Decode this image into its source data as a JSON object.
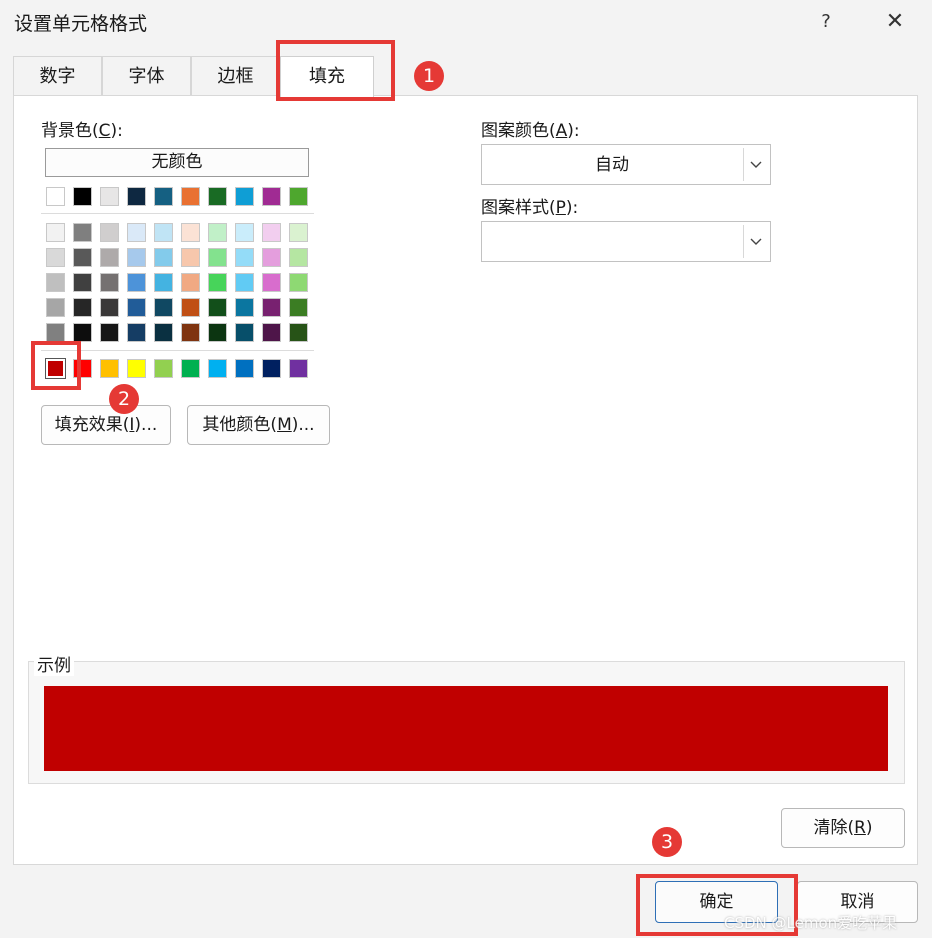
{
  "dialog": {
    "title": "设置单元格格式",
    "help_glyph": "?",
    "close_glyph": "✕"
  },
  "tabs": [
    {
      "label": "数字",
      "active": false
    },
    {
      "label": "字体",
      "active": false
    },
    {
      "label": "边框",
      "active": false
    },
    {
      "label": "填充",
      "active": true
    }
  ],
  "background_color": {
    "label_prefix": "背景色(",
    "accelerator": "C",
    "label_suffix": "):",
    "no_color_label": "无颜色",
    "theme_row": [
      "#ffffff",
      "#000000",
      "#e7e6e6",
      "#0e2841",
      "#156082",
      "#e97132",
      "#196b24",
      "#0f9ed5",
      "#a02b93",
      "#4ea72e"
    ],
    "tint_rows": [
      [
        "#f2f2f2",
        "#7f7f7f",
        "#d0cece",
        "#dae9f8",
        "#c0e4f5",
        "#fbe2d5",
        "#c1f0c8",
        "#caedfb",
        "#f2ceef",
        "#daf2d0"
      ],
      [
        "#d9d9d9",
        "#595959",
        "#aeaaaa",
        "#a6c9ec",
        "#83cbeb",
        "#f7c7ac",
        "#83e28e",
        "#94dcf8",
        "#e49edd",
        "#b5e6a2"
      ],
      [
        "#bfbfbf",
        "#404040",
        "#757171",
        "#4d93d9",
        "#44b3e1",
        "#f1a983",
        "#47d45a",
        "#61cbf4",
        "#d86dcd",
        "#8ed973"
      ],
      [
        "#a6a6a6",
        "#262626",
        "#3a3838",
        "#215c98",
        "#104862",
        "#c04f15",
        "#124f1a",
        "#0b76a0",
        "#782170",
        "#3b7d23"
      ],
      [
        "#808080",
        "#0d0d0d",
        "#161616",
        "#153d64",
        "#0a3041",
        "#7f3410",
        "#0c3511",
        "#074f6a",
        "#4e1549",
        "#275317"
      ]
    ],
    "standard_row": [
      "#c00000",
      "#ff0000",
      "#ffc000",
      "#ffff00",
      "#92d050",
      "#00b050",
      "#00b0f0",
      "#0070c0",
      "#002060",
      "#7030a0"
    ],
    "selected_color": "#c00000"
  },
  "buttons": {
    "fill_effects": {
      "text": "填充效果(",
      "accel": "I",
      "suffix": ")..."
    },
    "more_colors": {
      "text": "其他颜色(",
      "accel": "M",
      "suffix": ")..."
    },
    "clear": {
      "text": "清除(",
      "accel": "R",
      "suffix": ")"
    },
    "ok": "确定",
    "cancel": "取消"
  },
  "pattern_color": {
    "label_prefix": "图案颜色(",
    "accelerator": "A",
    "label_suffix": "):",
    "value": "自动"
  },
  "pattern_style": {
    "label_prefix": "图案样式(",
    "accelerator": "P",
    "label_suffix": "):",
    "value": ""
  },
  "sample": {
    "label": "示例",
    "color": "#c00000"
  },
  "annotations": {
    "badge_1": "1",
    "badge_2": "2",
    "badge_3": "3",
    "color": "#e53935"
  },
  "watermark": "CSDN @Lemon爱吃苹果"
}
